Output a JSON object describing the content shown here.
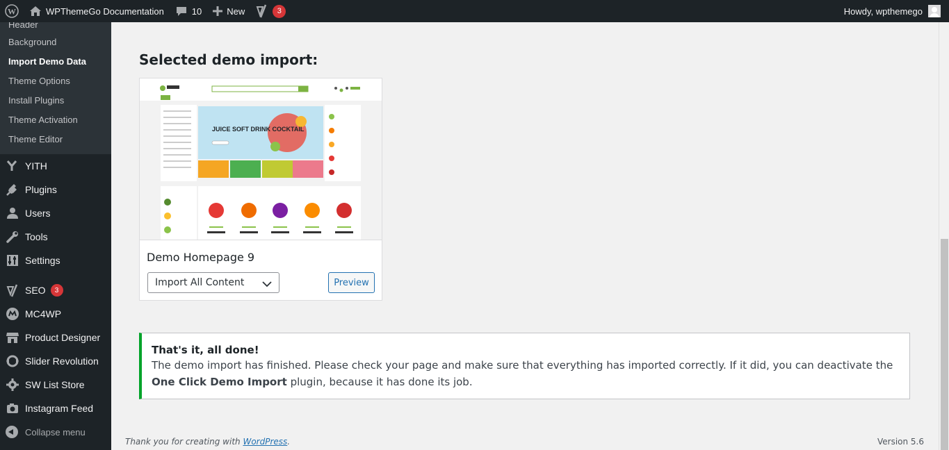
{
  "adminbar": {
    "site_name": "WPThemeGo Documentation",
    "comments_count": "10",
    "new_label": "New",
    "seo_badge": "3",
    "greeting": "Howdy, wpthemego"
  },
  "sidebar": {
    "submenu": [
      {
        "label": "Header"
      },
      {
        "label": "Background"
      },
      {
        "label": "Import Demo Data"
      },
      {
        "label": "Theme Options"
      },
      {
        "label": "Install Plugins"
      },
      {
        "label": "Theme Activation"
      },
      {
        "label": "Theme Editor"
      }
    ],
    "menu": [
      {
        "label": "YITH",
        "icon": "yith-icon"
      },
      {
        "label": "Plugins",
        "icon": "plugins-icon"
      },
      {
        "label": "Users",
        "icon": "users-icon"
      },
      {
        "label": "Tools",
        "icon": "tools-icon"
      },
      {
        "label": "Settings",
        "icon": "settings-icon"
      }
    ],
    "menu2": [
      {
        "label": "SEO",
        "icon": "yoast-icon",
        "badge": "3"
      },
      {
        "label": "MC4WP",
        "icon": "mc4wp-icon"
      },
      {
        "label": "Product Designer",
        "icon": "store-icon"
      },
      {
        "label": "Slider Revolution",
        "icon": "revolution-icon"
      },
      {
        "label": "SW List Store",
        "icon": "gear-icon"
      },
      {
        "label": "Instagram Feed",
        "icon": "camera-icon"
      }
    ],
    "collapse_label": "Collapse menu"
  },
  "main": {
    "section_title": "Selected demo import:",
    "demo": {
      "name": "Demo Homepage 9",
      "select_value": "Import All Content",
      "preview_label": "Preview",
      "thumb_text": "JUICE SOFT DRINK COCKTAIL"
    },
    "notice": {
      "title": "That's it, all done!",
      "body_before": "The demo import has finished. Please check your page and make sure that everything has imported correctly. If it did, you can deactivate the ",
      "body_strong": "One Click Demo Import",
      "body_after": " plugin, because it has done its job."
    },
    "footer": {
      "thanks_prefix": "Thank you for creating with ",
      "wordpress_link": "WordPress",
      "thanks_suffix": ".",
      "version": "Version 5.6"
    }
  },
  "colors": {
    "adminbar_bg": "#1d2327",
    "submenu_bg": "#2c3338",
    "accent_blue": "#2271b1",
    "success_green": "#00a32a",
    "badge_red": "#d63638"
  }
}
